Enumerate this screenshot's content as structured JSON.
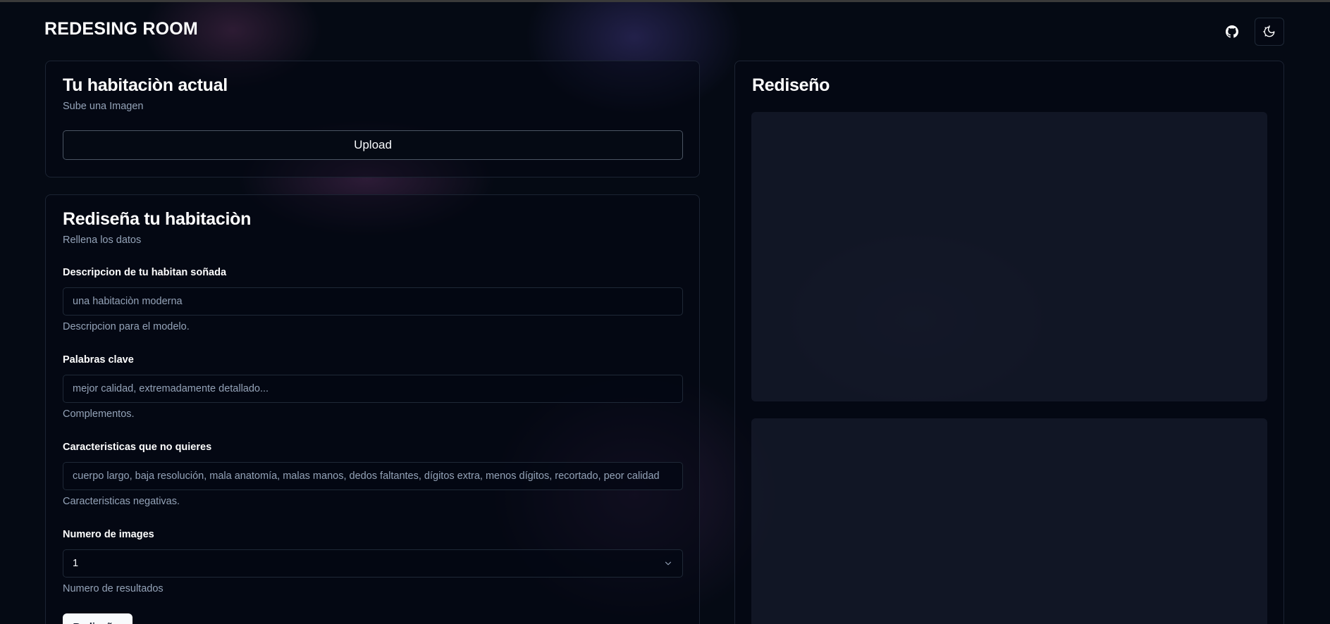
{
  "app": {
    "title": "REDESING ROOM"
  },
  "header": {
    "github_icon": "github-icon",
    "theme_icon": "theme-toggle-icon"
  },
  "upload_card": {
    "title": "Tu habitaciòn actual",
    "subtitle": "Sube una Imagen",
    "upload_label": "Upload"
  },
  "form_card": {
    "title": "Rediseña tu habitaciòn",
    "subtitle": "Rellena los datos",
    "fields": [
      {
        "label": "Descripcion de tu habitan soñada",
        "placeholder": "una habitaciòn moderna",
        "help": "Descripcion para el modelo."
      },
      {
        "label": "Palabras clave",
        "placeholder": "mejor calidad, extremadamente detallado...",
        "help": "Complementos."
      },
      {
        "label": "Caracteristicas que no quieres",
        "placeholder": "cuerpo largo, baja resolución, mala anatomía, malas manos, dedos faltantes, dígitos extra, menos dígitos, recortado, peor calidad",
        "help": "Caracteristicas negativas."
      }
    ],
    "num_images": {
      "label": "Numero de images",
      "value": "1",
      "help": "Numero de resultados"
    },
    "submit_label": "Rediseñar"
  },
  "result_card": {
    "title": "Rediseño"
  },
  "colors": {
    "background": "#050a14",
    "border": "#1c2433",
    "muted_text": "#94a3b8",
    "primary_button": "#f8fafc"
  }
}
